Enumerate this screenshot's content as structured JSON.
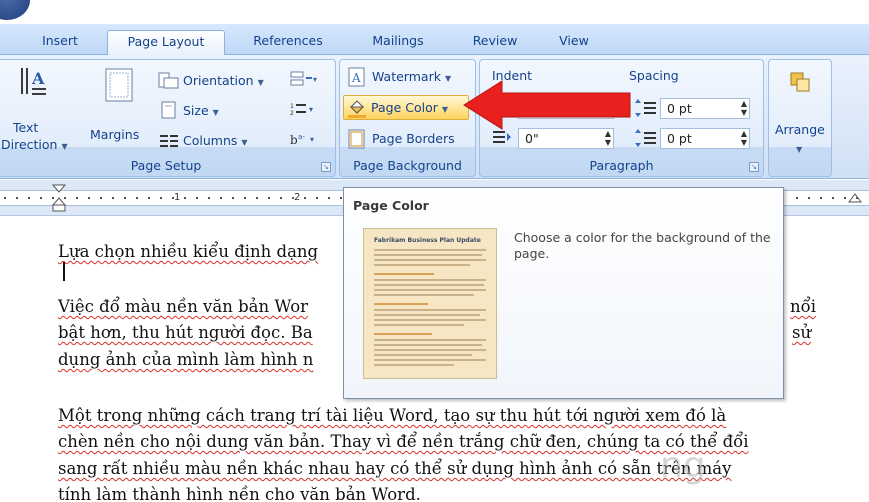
{
  "tabs": [
    "Insert",
    "Page Layout",
    "References",
    "Mailings",
    "Review",
    "View"
  ],
  "active_tab": "Page Layout",
  "page_setup": {
    "label": "Page Setup",
    "text_direction_line1": "Text",
    "text_direction_line2": "Direction",
    "margins": "Margins",
    "orientation": "Orientation",
    "size": "Size",
    "columns": "Columns"
  },
  "page_background": {
    "label": "Page Background",
    "watermark": "Watermark",
    "page_color": "Page Color",
    "page_borders": "Page Borders"
  },
  "paragraph": {
    "label": "Paragraph",
    "indent_header": "Indent",
    "indent_right_value": "0\"",
    "spacing_header": "Spacing",
    "spacing_before": "0 pt",
    "spacing_after": "0 pt"
  },
  "arrange": {
    "label": "Arrange"
  },
  "ruler": {
    "numbers": [
      "1",
      "2"
    ]
  },
  "tooltip": {
    "title": "Page Color",
    "description": "Choose a color for the background of the page.",
    "thumbnail_title": "Fabrikam Business Plan Update"
  },
  "document": {
    "lines": [
      "Lựa chọn nhiều kiểu định dạng",
      "Việc đổ màu nền văn bản Wor",
      "bật hơn, thu hút người đọc. Ba",
      "dụng ảnh của mình làm hình n",
      "Một trong những cách trang trí tài liệu Word, tạo sự thu hút tới người xem đó là",
      "chèn nền cho nội dung văn bản. Thay vì để nền trắng chữ đen, chúng ta có thể đổi",
      "sang rất nhiều màu nền khác nhau hay có thể sử dụng hình ảnh có sẵn trên máy",
      "tính làm thành hình nền cho văn bản Word."
    ],
    "right_fragments": [
      "nổi",
      "sử"
    ]
  },
  "watermark_text": "ng",
  "colors": {
    "ribbon": "#dbe8f8",
    "arrow": "#e8201e",
    "text": "#15428b"
  }
}
